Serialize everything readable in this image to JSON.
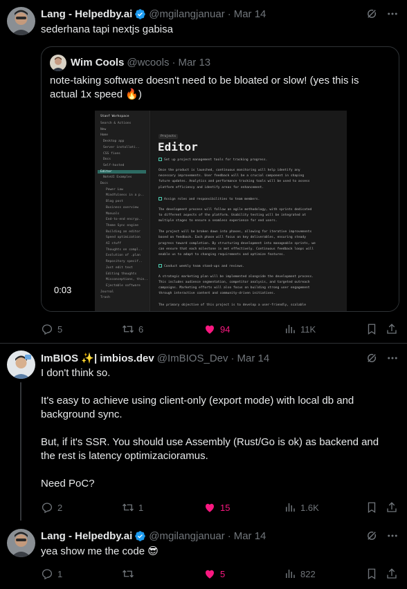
{
  "colors": {
    "background": "#000000",
    "text": "#e7e9ea",
    "muted": "#71767b",
    "like": "#f91880",
    "verified": "#1d9bf0",
    "divider": "#2f3336"
  },
  "tweets": [
    {
      "name": "Lang - Helpedby.ai",
      "handle": "@mgilangjanuar",
      "date": "Mar 14",
      "text": "sederhana tapi nextjs gabisa",
      "quote": {
        "name": "Wim Cools",
        "handle": "@wcools",
        "date": "Mar 13",
        "text": "note-taking software doesn't need to be bloated or slow! (yes this is actual 1x speed 🔥)",
        "video_time": "0:03",
        "app": {
          "workspace": "Stanf Workspace",
          "sidebar": [
            "Search & Actions",
            "New",
            "Home",
            "Desktop app",
            "Server installati..",
            "CSS fixes",
            "Docs",
            "Self-hosted",
            "Editor",
            "NoteUI Examples",
            "Docs",
            "Power Law",
            "Mindfulness in a p..",
            "Blog post",
            "Business overview",
            "Manuals",
            "End-to-end encryp..",
            "Theme Sync engine",
            "Building an editor",
            "Speed optimization",
            "AI stuff",
            "Thoughts on compl..",
            "Evolution of .plan",
            "Repository specif..",
            "Just edit text",
            "Editing thoughts",
            "Misconceptions, thin..",
            "Ejectable software",
            "Journal",
            "Trash"
          ],
          "chip": "Projects",
          "title": "Editor",
          "lines": [
            "Set up project management tools for tracking progress.",
            "",
            "Once the product is launched, continuous monitoring will help identify any",
            "necessary improvements. User feedback will be a crucial component in shaping",
            "future updates. Analytics and performance tracking tools will be used to assess",
            "platform efficiency and identify areas for enhancement.",
            "",
            "Assign roles and responsibilities to team members.",
            "",
            "The development process will follow an agile methodology, with sprints dedicated",
            "to different aspects of the platform. Usability testing will be integrated at",
            "multiple stages to ensure a seamless experience for end users.",
            "",
            "The project will be broken down into phases, allowing for iterative improvements",
            "based on feedback. Each phase will focus on key deliverables, ensuring steady",
            "progress toward completion. By structuring development into manageable sprints, we",
            "can ensure that each milestone is met effectively. Continuous feedback loops will",
            "enable us to adapt to changing requirements and optimize features.",
            "",
            "Conduct weekly team stand-ups and reviews.",
            "",
            "A strategic marketing plan will be implemented alongside the development process.",
            "This includes audience segmentation, competitor analysis, and targeted outreach",
            "campaigns. Marketing efforts will also focus on building strong user engagement",
            "through interactive content and community-driven initiatives.",
            "",
            "The primary objective of this project is to develop a user-friendly, scalable"
          ]
        }
      },
      "stats": {
        "replies": "5",
        "reposts": "6",
        "likes": "94",
        "views": "11K"
      }
    },
    {
      "name": "ImBIOS ✨| imbios.dev",
      "handle": "@ImBIOS_Dev",
      "date": "Mar 14",
      "text": "I don't think so.\n\nIt's easy to achieve using client-only (export mode) with local db and background sync.\n\nBut, if it's SSR. You should use Assembly (Rust/Go is ok) as backend and the rest is latency optimizacioramus.\n\nNeed PoC?",
      "stats": {
        "replies": "2",
        "reposts": "1",
        "likes": "15",
        "views": "1.6K"
      }
    },
    {
      "name": "Lang - Helpedby.ai",
      "handle": "@mgilangjanuar",
      "date": "Mar 14",
      "text": "yea show me the code 😎",
      "stats": {
        "replies": "1",
        "reposts": "",
        "likes": "5",
        "views": "822"
      }
    }
  ]
}
